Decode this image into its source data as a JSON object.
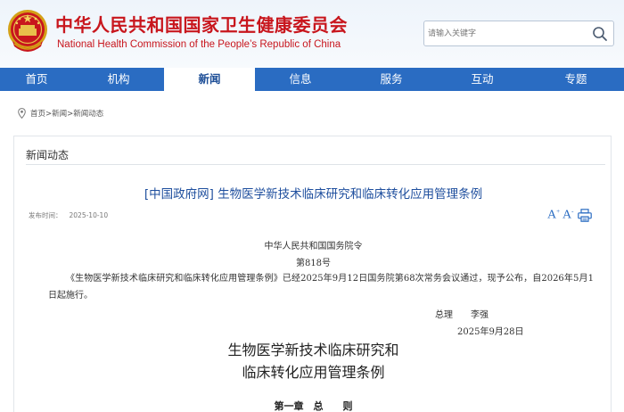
{
  "header": {
    "title_cn": "中华人民共和国国家卫生健康委员会",
    "title_en": "National Health Commission of the People’s Republic of China",
    "emblem_icon": "national-emblem-icon",
    "search": {
      "placeholder": "请输入关键字",
      "button_icon": "search-icon"
    }
  },
  "nav": {
    "items": [
      {
        "label": "首页"
      },
      {
        "label": "机构"
      },
      {
        "label": "新闻"
      },
      {
        "label": "信息"
      },
      {
        "label": "服务"
      },
      {
        "label": "互动"
      },
      {
        "label": "专题"
      }
    ],
    "active": "新闻"
  },
  "breadcrumb": {
    "icon": "location-pin-icon",
    "items": [
      "首页",
      "新闻",
      "新闻动态"
    ],
    "separator": ">"
  },
  "panel": {
    "title": "新闻动态"
  },
  "article": {
    "title": "[中国政府网] 生物医学新技术临床研究和临床转化应用管理条例",
    "pub_label": "发布时间：",
    "pub_date": "2025-10-10",
    "tools": {
      "font_large": "A",
      "font_small": "A",
      "font_large_sup": "+",
      "font_small_sup": "-",
      "print_icon": "print-icon"
    },
    "decree_header": "中华人民共和国国务院令",
    "decree_number": "第818号",
    "decree_text": "《生物医学新技术临床研究和临床转化应用管理条例》已经2025年9月12日国务院第68次常务会议通过，现予公布，自2026年5月1日起施行。",
    "signatory": "总理　　李强",
    "sign_date": "2025年9月28日",
    "doc_title_line1": "生物医学新技术临床研究和",
    "doc_title_line2": "临床转化应用管理条例",
    "chapter": "第一章　总　　则"
  },
  "colors": {
    "brand_red": "#c8161d",
    "nav_blue": "#2a6cc2",
    "title_blue": "#1f4f9e"
  }
}
